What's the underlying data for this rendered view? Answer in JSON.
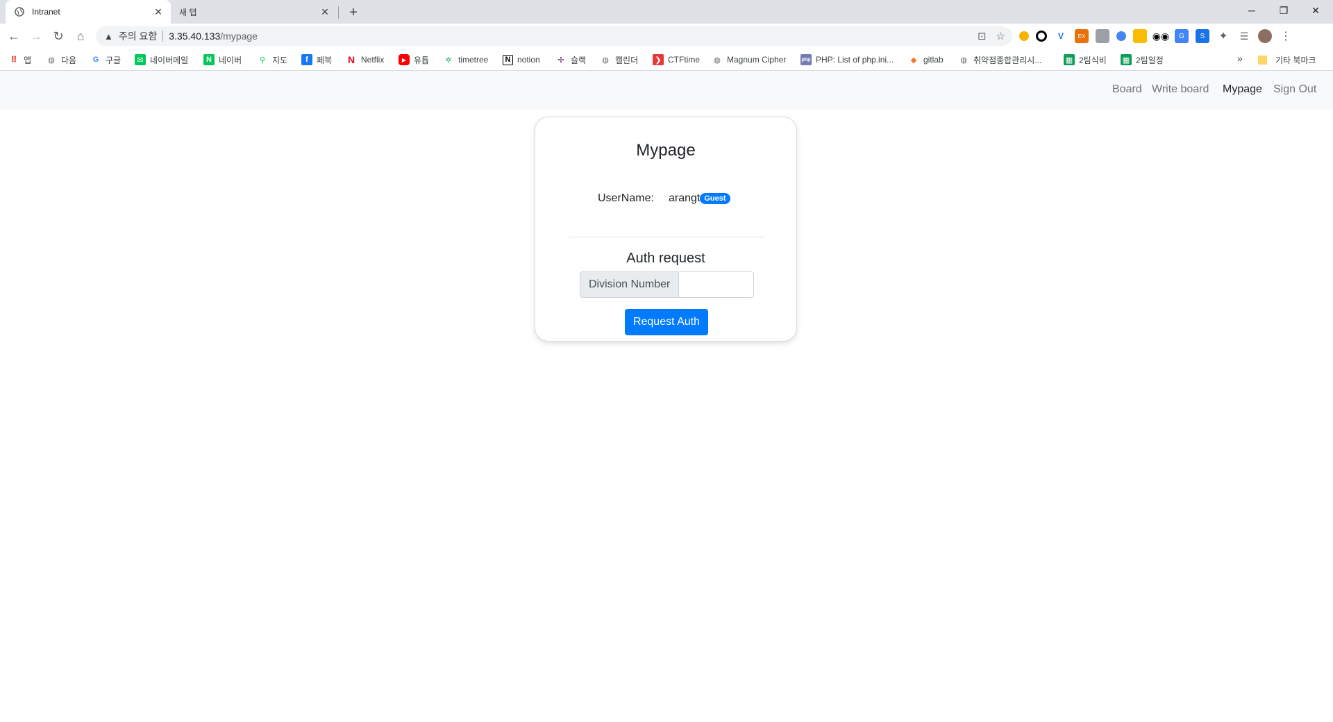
{
  "browser": {
    "tabs": [
      {
        "title": "Intranet",
        "active": true
      },
      {
        "title": "새 탭",
        "active": false
      }
    ],
    "omnibox": {
      "warning_label": "주의 요함",
      "host": "3.35.40.133",
      "path": "/mypage"
    },
    "bookmarks": [
      {
        "label": "앱",
        "icon": "apps-grid-icon"
      },
      {
        "label": "다음",
        "icon": "globe-icon"
      },
      {
        "label": "구글",
        "icon": "google-icon"
      },
      {
        "label": "네이버메일",
        "icon": "naver-mail-icon"
      },
      {
        "label": "네이버",
        "icon": "naver-icon"
      },
      {
        "label": "지도",
        "icon": "map-icon"
      },
      {
        "label": "페북",
        "icon": "facebook-icon"
      },
      {
        "label": "Netflix",
        "icon": "netflix-icon"
      },
      {
        "label": "유튭",
        "icon": "youtube-icon"
      },
      {
        "label": "timetree",
        "icon": "timetree-icon"
      },
      {
        "label": "notion",
        "icon": "notion-icon"
      },
      {
        "label": "슬랙",
        "icon": "slack-icon"
      },
      {
        "label": "캘린더",
        "icon": "globe-icon"
      },
      {
        "label": "CTFtime",
        "icon": "ctftime-icon"
      },
      {
        "label": "Magnum Cipher",
        "icon": "globe-icon"
      },
      {
        "label": "PHP: List of php.ini...",
        "icon": "php-icon"
      },
      {
        "label": "gitlab",
        "icon": "gitlab-icon"
      },
      {
        "label": "취약점종합관리시...",
        "icon": "globe-icon"
      },
      {
        "label": "2팀식비",
        "icon": "sheets-icon"
      },
      {
        "label": "2팀일정",
        "icon": "sheets-icon"
      }
    ],
    "bookmarks_more": "»",
    "other_bookmarks": "기타 북마크"
  },
  "navbar": {
    "links": [
      {
        "label": "Board",
        "active": false
      },
      {
        "label": "Write board",
        "active": false
      },
      {
        "label": "Mypage",
        "active": true
      },
      {
        "label": "Sign Out",
        "active": false
      }
    ]
  },
  "mypage": {
    "title": "Mypage",
    "username_label": "UserName:",
    "username_value": "arangt",
    "role_badge": "Guest",
    "auth_title": "Auth request",
    "division_label": "Division Number",
    "division_value": "",
    "request_button": "Request Auth"
  },
  "colors": {
    "primary": "#007bff",
    "navbar_bg": "#f8f9fa",
    "tabstrip_bg": "#dee1e6"
  }
}
